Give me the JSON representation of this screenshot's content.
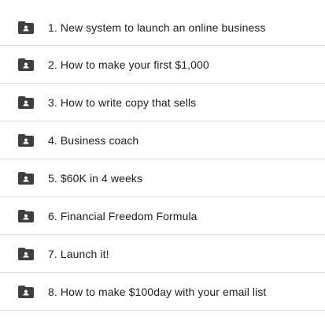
{
  "folders": {
    "items": [
      {
        "label": "1. New system to launch an online business",
        "icon": "shared-folder-icon"
      },
      {
        "label": "2. How to make your first $1,000",
        "icon": "shared-folder-icon"
      },
      {
        "label": "3. How to write copy that sells",
        "icon": "shared-folder-icon"
      },
      {
        "label": "4. Business coach",
        "icon": "shared-folder-icon"
      },
      {
        "label": "5. $60K in 4 weeks",
        "icon": "shared-folder-icon"
      },
      {
        "label": "6. Financial Freedom Formula",
        "icon": "shared-folder-icon"
      },
      {
        "label": "7. Launch it!",
        "icon": "shared-folder-icon"
      },
      {
        "label": "8. How to make $100day with your email list",
        "icon": "shared-folder-icon"
      }
    ]
  },
  "colors": {
    "icon": "#3c4043",
    "text": "#202124",
    "divider": "#dadce0"
  }
}
